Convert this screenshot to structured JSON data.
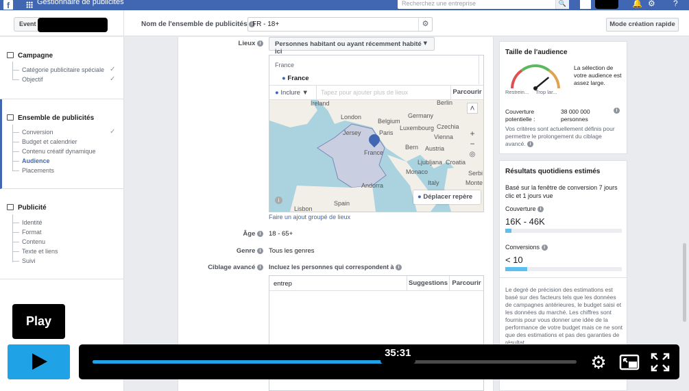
{
  "topbar": {
    "logo": "f",
    "title": "Gestionnaire de publicités",
    "search_placeholder": "Recherchez une entreprise",
    "search_icon": "magnifier-icon",
    "notifications_icon": "bell-icon",
    "settings_icon": "gear-icon",
    "help_icon": "help-icon"
  },
  "header": {
    "event_label": "Event",
    "adset_name_label": "Nom de l'ensemble de publicités",
    "adset_name_value": "FR - 18+",
    "quick_mode_button": "Mode création rapide"
  },
  "sidebar": {
    "sections": [
      {
        "title": "Campagne",
        "items": [
          {
            "label": "Catégorie publicitaire spéciale",
            "done": true
          },
          {
            "label": "Objectif",
            "done": true
          }
        ]
      },
      {
        "title": "Ensemble de publicités",
        "items": [
          {
            "label": "Conversion",
            "done": true
          },
          {
            "label": "Budget et calendrier",
            "done": false
          },
          {
            "label": "Contenu créatif dynamique",
            "done": false
          },
          {
            "label": "Audience",
            "done": false,
            "current": true
          },
          {
            "label": "Placements",
            "done": false
          }
        ]
      },
      {
        "title": "Publicité",
        "items": [
          {
            "label": "Identité"
          },
          {
            "label": "Format"
          },
          {
            "label": "Contenu"
          },
          {
            "label": "Texte et liens"
          },
          {
            "label": "Suivi"
          }
        ]
      }
    ],
    "check_glyph": "✓"
  },
  "main": {
    "locations_label": "Lieux",
    "locations_dropdown": "Personnes habitant ou ayant récemment habité ici",
    "location_country": "France",
    "location_item": "France",
    "include_label": "Inclure",
    "include_placeholder": "Tapez pour ajouter plus de lieux",
    "browse_label": "Parcourir",
    "move_pin_label": "Déplacer repère",
    "map_labels": {
      "ireland": "Ireland",
      "berlin": "Berlin",
      "germany": "Germany",
      "london": "London",
      "belgium": "Belgium",
      "jersey": "Jersey",
      "luxembourg": "Luxembourg",
      "czechia": "Czechia",
      "paris": "Paris",
      "vienna": "Vienna",
      "bern": "Bern",
      "austria": "Austria",
      "ljubljana": "Ljubljana",
      "croatia": "Croatia",
      "france": "France",
      "monaco": "Monaco",
      "italy": "Italy",
      "andorra": "Andorra",
      "serbia": "Serbi",
      "montenegro": "Monte",
      "spain": "Spain",
      "lisbon": "Lisbon"
    },
    "bulk_link": "Faire un ajout groupé de lieux",
    "age_label": "Âge",
    "age_value": "18 - 65+",
    "gender_label": "Genre",
    "gender_value": "Tous les genres",
    "targeting_label": "Ciblage avancé",
    "targeting_sub": "Incluez les personnes qui correspondent à",
    "targeting_input": "entrep",
    "suggestions_label": "Suggestions",
    "browse2_label": "Parcourir"
  },
  "audience": {
    "title": "Taille de l'audience",
    "gauge_message": "La sélection de votre audience est assez large.",
    "gauge_left": "Restrein...",
    "gauge_right": "Trop lar...",
    "gauge_level": 0.78,
    "reach_label": "Couverture potentielle :",
    "reach_value": "38 000 000 personnes",
    "note": "Vos critères sont actuellement définis pour permettre le prolongement du ciblage avancé."
  },
  "daily": {
    "title": "Résultats quotidiens estimés",
    "basis": "Basé sur la fenêtre de conversion 7 jours clic et 1 jours vue",
    "coverage_label": "Couverture",
    "coverage_value": "16K - 46K",
    "coverage_level": 0.05,
    "conversions_label": "Conversions",
    "conversions_value": "< 10",
    "conversions_level": 0.19,
    "disclaimer": "Le degré de précision des estimations est basé sur des facteurs tels que les données de campagnes antérieures, le budget saisi et les données du marché. Les chiffres sont fournis pour vous donner une idée de la performance de votre budget mais ce ne sont que des estimations et pas des garanties de résultat."
  },
  "video": {
    "play_tooltip": "Play",
    "time": "35:31",
    "progress": 0.63,
    "buffered": 0.65,
    "settings_icon": "gear-icon",
    "pip_icon": "picture-in-picture-icon",
    "fullscreen_icon": "fullscreen-icon"
  },
  "colors": {
    "accent": "#4267b2",
    "video_accent": "#1fa2e6",
    "bar": "#5dbef0"
  }
}
